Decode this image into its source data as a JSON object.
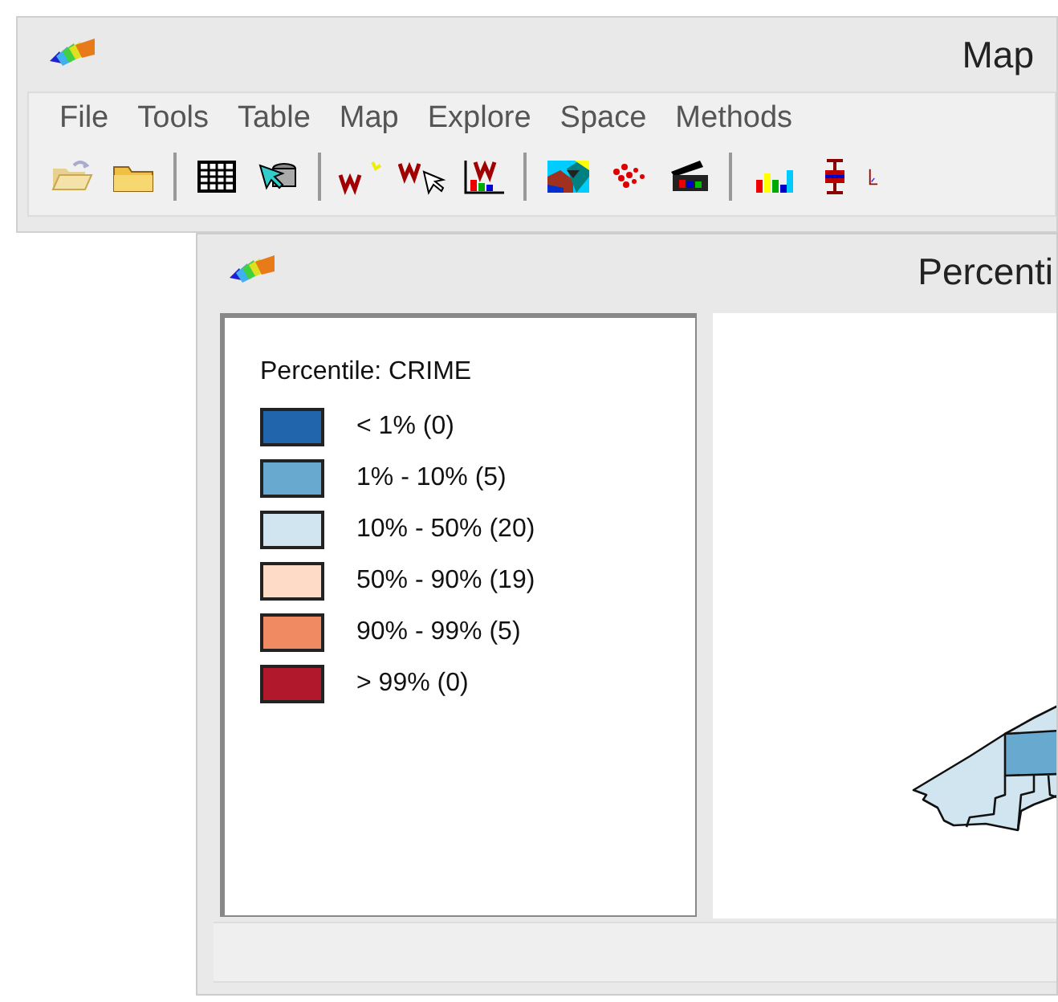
{
  "main_window": {
    "title": "Map",
    "menu": [
      "File",
      "Tools",
      "Table",
      "Map",
      "Explore",
      "Space",
      "Methods"
    ]
  },
  "map_window": {
    "title": "Percenti",
    "legend": {
      "title": "Percentile: CRIME",
      "items": [
        {
          "label": "< 1% (0)",
          "color": "#2166ac"
        },
        {
          "label": "1% - 10% (5)",
          "color": "#67a9cf"
        },
        {
          "label": "10% - 50% (20)",
          "color": "#d1e5f0"
        },
        {
          "label": "50% - 90% (19)",
          "color": "#fddbc7"
        },
        {
          "label": "90% - 99% (5)",
          "color": "#ef8a62"
        },
        {
          "label": "> 99% (0)",
          "color": "#b2182b"
        }
      ]
    }
  }
}
